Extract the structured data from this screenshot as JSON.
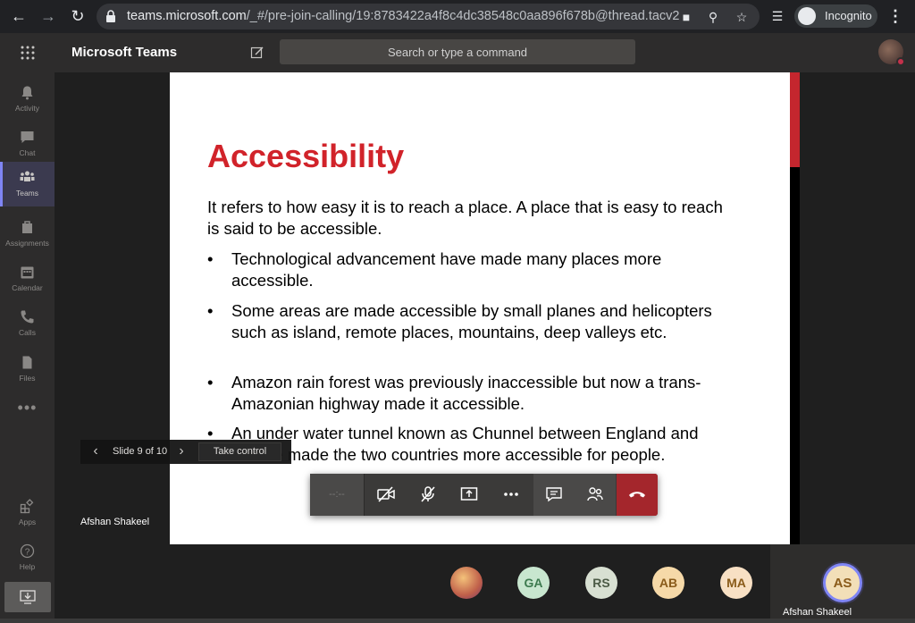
{
  "browser": {
    "url_host": "teams.microsoft.com",
    "url_path": "/_#/pre-join-calling/19:8783422a4f8c4dc38548c0aa896f678b@thread.tacv2",
    "incognito_label": "Incognito"
  },
  "header": {
    "app_title": "Microsoft Teams",
    "search_placeholder": "Search or type a command"
  },
  "rail": {
    "items": [
      {
        "label": "Activity"
      },
      {
        "label": "Chat"
      },
      {
        "label": "Teams"
      },
      {
        "label": "Assignments"
      },
      {
        "label": "Calendar"
      },
      {
        "label": "Calls"
      },
      {
        "label": "Files"
      },
      {
        "label": "Apps"
      },
      {
        "label": "Help"
      }
    ],
    "more": "•••"
  },
  "slide": {
    "title": "Accessibility",
    "intro": "It refers to how easy it is to reach a place. A place that is easy to reach is said to be accessible.",
    "bullets": [
      "Technological advancement have made many places more accessible.",
      "Some areas are made accessible by small planes and helicopters such as island, remote places, mountains, deep valleys etc.",
      "Amazon rain forest was previously inaccessible but now a trans-Amazonian highway made it accessible.",
      "An under water tunnel known as Chunnel between England and France made the two countries more accessible for people."
    ],
    "bullet_char": "•"
  },
  "slide_controls": {
    "counter": "Slide 9 of 10",
    "take_control": "Take control"
  },
  "call": {
    "timer": "--:--",
    "presenter_name": "Afshan Shakeel"
  },
  "participants": [
    {
      "initials": "GA",
      "bg": "#c8e6cf",
      "fg": "#3d7a4f"
    },
    {
      "initials": "RS",
      "bg": "#d8e0d2",
      "fg": "#4b5a45"
    },
    {
      "initials": "AB",
      "bg": "#f6d9a8",
      "fg": "#8a5b1a"
    },
    {
      "initials": "MA",
      "bg": "#f8e0c4",
      "fg": "#8a5b1a"
    }
  ],
  "self": {
    "initials": "AS",
    "name": "Afshan Shakeel"
  },
  "colors": {
    "accent": "#7f85f5",
    "title_red": "#d1232a",
    "hangup": "#a4262c"
  }
}
